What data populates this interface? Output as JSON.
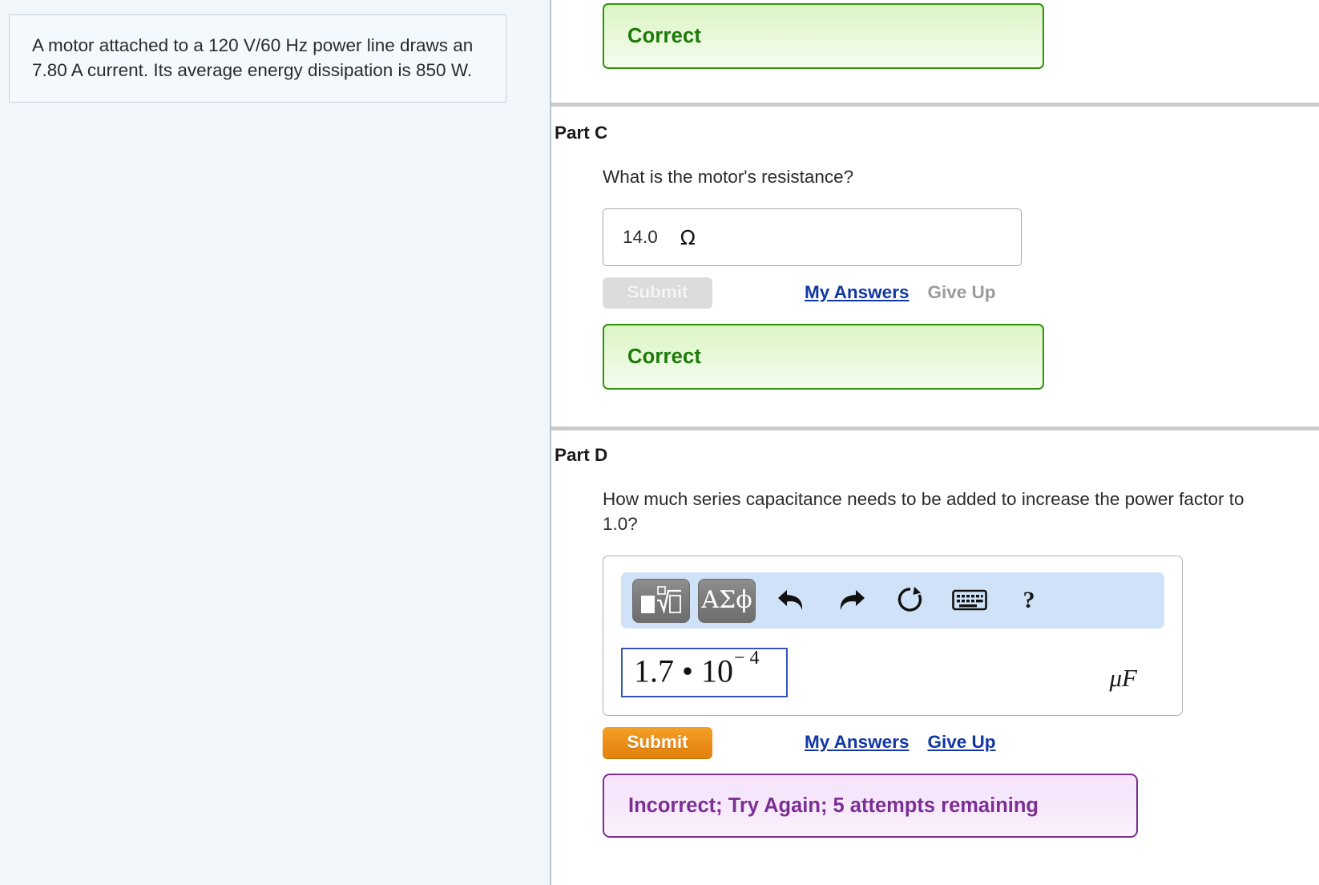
{
  "problem": {
    "statement": "A motor attached to a 120 V/60 Hz power line draws an 7.80 A current. Its average energy dissipation is 850 W."
  },
  "part_b_feedback": {
    "label": "Correct"
  },
  "part_c": {
    "title": "Part C",
    "question": "What is the motor's resistance?",
    "answer_value": "14.0",
    "answer_unit": "Ω",
    "submit_label": "Submit",
    "my_answers_label": "My Answers",
    "give_up_label": "Give Up",
    "feedback_label": "Correct"
  },
  "part_d": {
    "title": "Part D",
    "question": "How much series capacitance needs to be added to increase the power factor to 1.0?",
    "toolbar": {
      "math_template_label": "■√□",
      "greek_label": "ΑΣϕ",
      "undo_icon": "undo-arrow",
      "redo_icon": "redo-arrow",
      "reset_icon": "reset-circular-arrow",
      "keyboard_icon": "keyboard",
      "help_label": "?"
    },
    "answer_mantissa": "1.7 • 10",
    "answer_exponent": "− 4",
    "answer_unit": "μF",
    "submit_label": "Submit",
    "my_answers_label": "My Answers",
    "give_up_label": "Give Up",
    "feedback_label": "Incorrect; Try Again; 5 attempts remaining"
  },
  "colors": {
    "correct_green": "#1b7a06",
    "incorrect_purple": "#7b2f93",
    "submit_orange": "#ea8c15",
    "link_blue": "#1137a3",
    "toolbar_blue": "#cfe2f7"
  }
}
